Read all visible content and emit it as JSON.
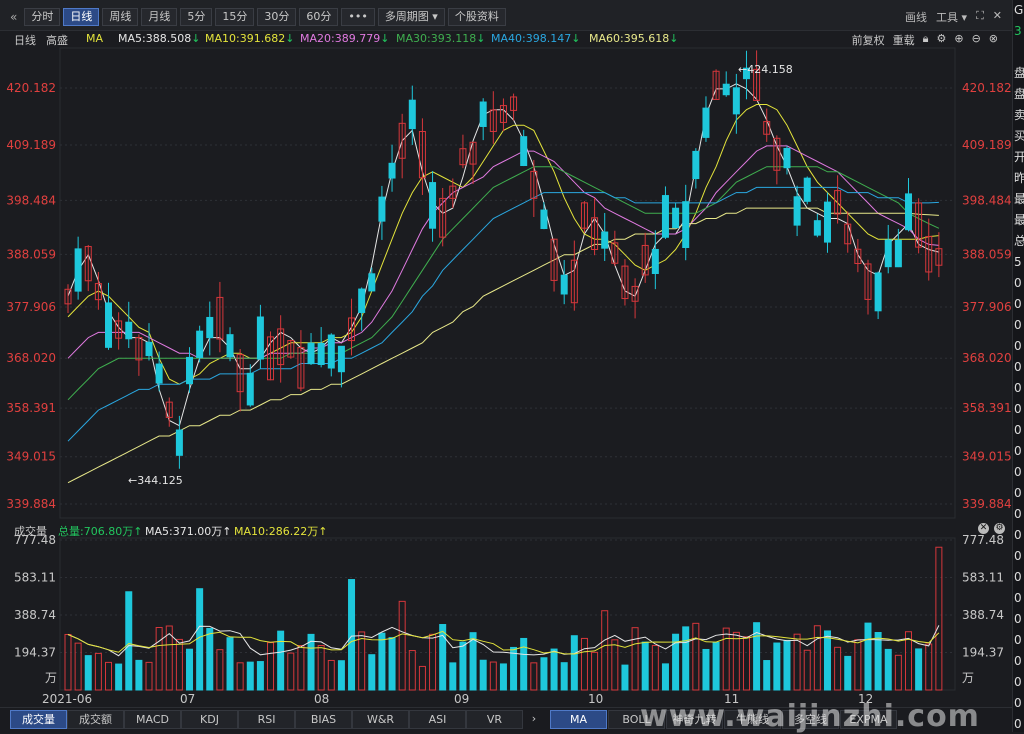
{
  "toolbar": {
    "tabs": [
      "分时",
      "日线",
      "周线",
      "月线",
      "5分",
      "15分",
      "30分",
      "60分",
      "•••",
      "多周期图 ▾",
      "个股资料"
    ],
    "active_tab": 1,
    "right_items": [
      "画线",
      "工具 ▾"
    ]
  },
  "ma_row": {
    "period": "日线",
    "stock": "高盛",
    "indicator": "MA",
    "ma_values": [
      {
        "label": "MA5:388.508",
        "arrow": "↓",
        "color": "#e6e6e6",
        "arrow_color": "#22c55e"
      },
      {
        "label": "MA10:391.682",
        "arrow": "↓",
        "color": "#e3e33b",
        "arrow_color": "#22c55e"
      },
      {
        "label": "MA20:389.779",
        "arrow": "↓",
        "color": "#e07ae0",
        "arrow_color": "#22c55e"
      },
      {
        "label": "MA30:393.118",
        "arrow": "↓",
        "color": "#3fae4f",
        "arrow_color": "#22c55e"
      },
      {
        "label": "MA40:398.147",
        "arrow": "↓",
        "color": "#2aa7e0",
        "arrow_color": "#22c55e"
      },
      {
        "label": "MA60:395.618",
        "arrow": "↓",
        "color": "#e8e88a",
        "arrow_color": "#22c55e"
      }
    ],
    "right": [
      "前复权",
      "重载"
    ]
  },
  "chart_data": [
    {
      "type": "candlestick",
      "title": "",
      "xlabel": "",
      "ylabel": "",
      "y_ticks": [
        "420.182",
        "409.189",
        "398.484",
        "388.059",
        "377.906",
        "368.020",
        "358.391",
        "349.015",
        "339.884"
      ],
      "ylim": [
        339.884,
        420.182
      ],
      "x_ticks": [
        "2021-06",
        "07",
        "08",
        "09",
        "10",
        "11",
        "12"
      ],
      "annotations": [
        {
          "text": "←424.158",
          "value": 424.158
        },
        {
          "text": "←344.125",
          "value": 344.125
        }
      ],
      "ma_lines": {
        "MA5": [
          380,
          385,
          388,
          383,
          377,
          374,
          372,
          372,
          371,
          362,
          356,
          355,
          362,
          368,
          372,
          372,
          370,
          366,
          366,
          368,
          371,
          373,
          372,
          370,
          369,
          370,
          372,
          371,
          374,
          378,
          386,
          396,
          404,
          410,
          412,
          404,
          398,
          396,
          397,
          403,
          410,
          415,
          416,
          416,
          414,
          410,
          405,
          398,
          390,
          384,
          385,
          392,
          395,
          392,
          386,
          381,
          380,
          385,
          390,
          392,
          392,
          395,
          405,
          415,
          420,
          420,
          421,
          420,
          418,
          414,
          409,
          405,
          400,
          397,
          396,
          395,
          395,
          394,
          388,
          385,
          384,
          390,
          392,
          394,
          390,
          389,
          388.5
        ],
        "MA10": [
          376,
          378,
          380,
          381,
          380,
          378,
          376,
          374,
          373,
          368,
          364,
          363,
          364,
          365,
          367,
          368,
          369,
          369,
          368,
          368,
          369,
          370,
          371,
          371,
          371,
          371,
          372,
          372,
          373,
          376,
          381,
          386,
          391,
          396,
          400,
          403,
          404,
          403,
          402,
          401,
          403,
          406,
          409,
          412,
          413,
          413,
          412,
          408,
          404,
          399,
          395,
          392,
          391,
          391,
          390,
          388,
          386,
          385,
          386,
          387,
          389,
          392,
          396,
          401,
          405,
          410,
          414,
          416,
          417,
          417,
          416,
          413,
          409,
          405,
          402,
          400,
          398,
          396,
          394,
          392,
          391,
          391,
          391,
          391,
          391,
          391.5,
          391.7
        ],
        "MA20": [
          368,
          370,
          372,
          373,
          373,
          373,
          373,
          373,
          372,
          371,
          370,
          369,
          369,
          368,
          368,
          368,
          368,
          368,
          368,
          368,
          369,
          369,
          369,
          369,
          370,
          370,
          371,
          371,
          372,
          373,
          375,
          378,
          381,
          385,
          389,
          393,
          396,
          398,
          400,
          401,
          402,
          403,
          405,
          406,
          407,
          408,
          408,
          407,
          406,
          404,
          402,
          400,
          399,
          397,
          396,
          395,
          394,
          393,
          392,
          392,
          392,
          393,
          395,
          397,
          400,
          402,
          404,
          406,
          408,
          409,
          409,
          409,
          408,
          407,
          406,
          405,
          404,
          402,
          400,
          398,
          396,
          395,
          394,
          393,
          391,
          390,
          389.8
        ],
        "MA30": [
          360,
          362,
          364,
          366,
          367,
          368,
          368,
          368,
          368,
          368,
          368,
          368,
          368,
          368,
          368,
          368,
          368,
          368,
          368,
          368,
          368,
          368,
          369,
          369,
          369,
          369,
          369,
          369,
          370,
          371,
          372,
          374,
          376,
          379,
          382,
          385,
          388,
          391,
          393,
          395,
          397,
          399,
          401,
          402,
          403,
          404,
          405,
          405,
          405,
          404,
          403,
          402,
          401,
          400,
          399,
          398,
          397,
          396,
          396,
          396,
          396,
          396,
          396,
          397,
          398,
          400,
          402,
          403,
          404,
          405,
          405,
          405,
          405,
          405,
          405,
          404,
          404,
          403,
          402,
          401,
          400,
          399,
          398,
          396,
          395,
          394,
          393.1
        ],
        "MA40": [
          352,
          354,
          356,
          358,
          359,
          360,
          361,
          362,
          362,
          363,
          363,
          363,
          364,
          364,
          364,
          365,
          365,
          365,
          365,
          366,
          366,
          366,
          366,
          367,
          367,
          367,
          367,
          368,
          368,
          369,
          370,
          371,
          373,
          375,
          377,
          380,
          382,
          385,
          387,
          389,
          391,
          393,
          395,
          396,
          397,
          398,
          399,
          400,
          400,
          400,
          400,
          400,
          400,
          400,
          399,
          399,
          398,
          398,
          398,
          398,
          398,
          398,
          398,
          398,
          398,
          399,
          400,
          400,
          401,
          401,
          401,
          401,
          401,
          401,
          401,
          401,
          401,
          400,
          400,
          400,
          399,
          399,
          399,
          398,
          398,
          398,
          398.1
        ],
        "MA60": [
          344,
          345,
          346,
          347,
          348,
          349,
          350,
          351,
          352,
          353,
          353,
          354,
          355,
          355,
          356,
          357,
          357,
          358,
          358,
          359,
          360,
          360,
          361,
          361,
          362,
          362,
          363,
          363,
          364,
          365,
          366,
          367,
          368,
          369,
          370,
          371,
          373,
          374,
          375,
          377,
          378,
          380,
          381,
          382,
          383,
          384,
          385,
          386,
          387,
          388,
          388,
          389,
          390,
          390,
          391,
          391,
          392,
          392,
          392,
          393,
          393,
          394,
          394,
          395,
          395,
          396,
          396,
          397,
          397,
          397,
          397,
          397,
          397,
          397,
          397,
          396,
          396,
          396,
          396,
          396,
          396,
          396,
          396,
          396,
          395.8,
          395.7,
          395.6
        ]
      }
    },
    {
      "type": "bar",
      "title": "成交量",
      "xlabel": "",
      "ylabel": "万",
      "y_ticks": [
        "777.48",
        "583.11",
        "388.74",
        "194.37"
      ],
      "ylim": [
        0,
        777.48
      ],
      "total_label": "总量:706.80万",
      "ma5_label": "MA5:371.00万",
      "ma10_label": "MA10:286.22万"
    }
  ],
  "vol_header": {
    "title": "成交量",
    "total": "总量:706.80万↑",
    "ma5": "MA5:371.00万↑",
    "ma10": "MA10:286.22万↑"
  },
  "bottom_tabs": [
    "成交量",
    "成交额",
    "MACD",
    "KDJ",
    "RSI",
    "BIAS",
    "W&R",
    "ASI",
    "VR"
  ],
  "bottom_tabs2": [
    "MA",
    "BOLL",
    "神奇九转",
    "牛熊线",
    "多空线",
    "EXPMA"
  ],
  "watermark": "www.waijinzhi.com",
  "side_chars": [
    "G",
    "3",
    "",
    "盘",
    "盘",
    "卖",
    "买",
    "开",
    "昨",
    "最",
    "最",
    "总",
    "5",
    "0",
    "0",
    "0",
    "0",
    "0",
    "0",
    "0",
    "0",
    "0",
    "0",
    "0",
    "0",
    "0",
    "0",
    "0",
    "0",
    "0",
    "0",
    "0",
    "0",
    "0",
    "0"
  ],
  "colors": {
    "up": "#d6373b",
    "down": "#1ec8dc",
    "bg": "#1b1c20",
    "grid": "#2e3036",
    "axis_red": "#e0403f"
  }
}
